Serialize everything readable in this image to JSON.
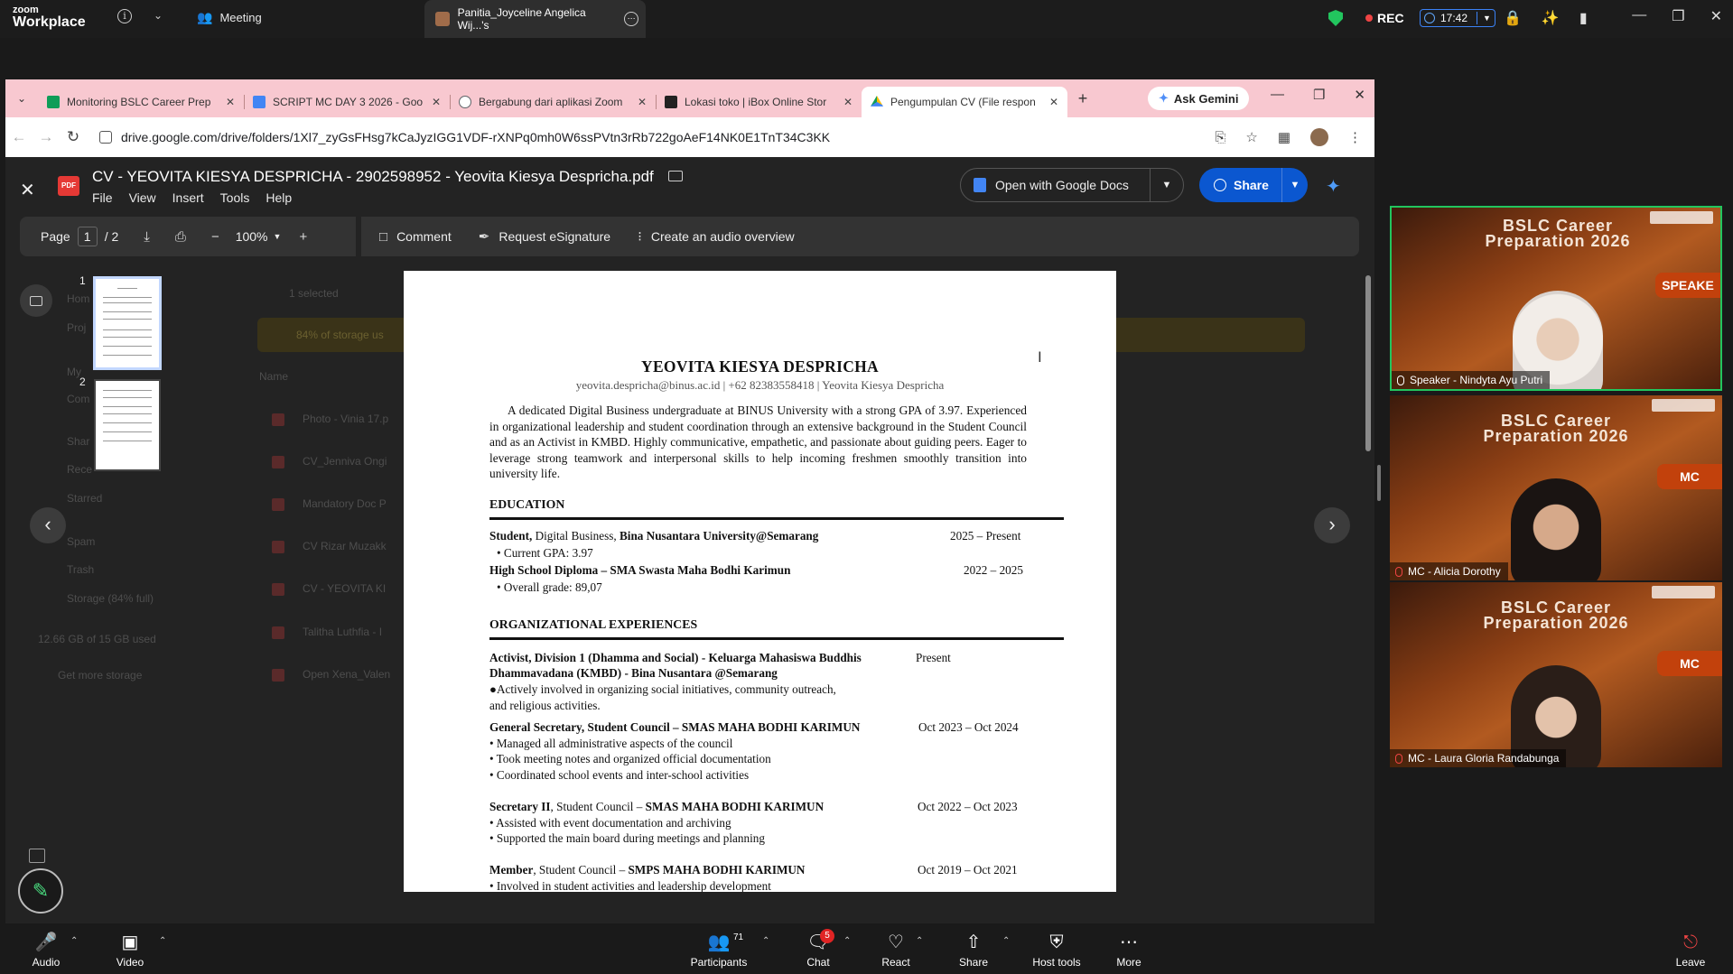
{
  "zoom": {
    "logo_line1": "zoom",
    "logo_line2": "Workplace",
    "meeting_label": "Meeting",
    "share_tab_title": "Panitia_Joyceline Angelica Wij...'s",
    "rec_label": "REC",
    "timer": "17:42",
    "bottom": {
      "audio": "Audio",
      "video": "Video",
      "participants": "Participants",
      "participants_count": "71",
      "chat": "Chat",
      "chat_badge": "5",
      "react": "React",
      "share": "Share",
      "host_tools": "Host tools",
      "more": "More",
      "leave": "Leave"
    },
    "participants": [
      {
        "title_line1": "BSLC Career",
        "title_line2": "Preparation 2026",
        "badge": "SPEAKE",
        "name": "Speaker - Nindyta Ayu Putri",
        "active": true
      },
      {
        "title_line1": "BSLC Career",
        "title_line2": "Preparation 2026",
        "badge": "MC",
        "name": "MC - Alicia Dorothy",
        "active": false
      },
      {
        "title_line1": "BSLC Career",
        "title_line2": "Preparation 2026",
        "badge": "MC",
        "name": "MC - Laura Gloria Randabunga",
        "active": false
      }
    ]
  },
  "chrome": {
    "tabs": [
      {
        "title": "Monitoring BSLC Career Prep",
        "fav_color": "#0f9d58"
      },
      {
        "title": "SCRIPT MC DAY 3 2026 - Goo",
        "fav_color": "#4285f4"
      },
      {
        "title": "Bergabung dari aplikasi Zoom",
        "fav_color": "#5f6368"
      },
      {
        "title": "Lokasi toko | iBox Online Stor",
        "fav_color": "#222222"
      },
      {
        "title": "Pengumpulan CV (File respon",
        "fav_color": "#fbbc04"
      }
    ],
    "ask_gemini": "Ask Gemini",
    "url": "drive.google.com/drive/folders/1Xl7_zyGsFHsg7kCaJyzIGG1VDF-rXNPq0mh0W6ssPVtn3rRb722goAeF14NK0E1TnT34C3KK"
  },
  "drive_bg": {
    "selected": "1 selected",
    "storage_warning": "84% of storage us",
    "name_header": "Name",
    "sidebar": [
      "Hom",
      "Proj",
      "My",
      "Com",
      "Shar",
      "Rece",
      "Starred",
      "Spam",
      "Trash",
      "Storage (84% full)",
      "12.66 GB of 15 GB used",
      "Get more storage"
    ],
    "files": [
      "Photo - Vinia 17.p",
      "CV_Jenniva Ongi",
      "Mandatory Doc P",
      "CV Rizar Muzakk",
      "CV - YEOVITA KI",
      "Talitha Luthfia - I",
      "Open Xena_Valen"
    ]
  },
  "viewer": {
    "title": "CV - YEOVITA KIESYA DESPRICHA - 2902598952 - Yeovita Kiesya Despricha.pdf",
    "menu": [
      "File",
      "View",
      "Insert",
      "Tools",
      "Help"
    ],
    "open_with": "Open with Google Docs",
    "share": "Share",
    "page_label": "Page",
    "page_current": "1",
    "page_total": "/  2",
    "zoom": "100%",
    "comment": "Comment",
    "esign": "Request eSignature",
    "audio_overview": "Create an audio overview",
    "thumb_nums": [
      "1",
      "2"
    ]
  },
  "cv": {
    "name": "YEOVITA KIESYA DESPRICHA",
    "contact": "yeovita.despricha@binus.ac.id | +62 82383558418 | Yeovita Kiesya Despricha",
    "summary": "A dedicated Digital Business undergraduate at BINUS University with a strong GPA of 3.97. Experienced in organizational leadership and student coordination through an extensive background in the Student Council and as an Activist in KMBD. Highly communicative, empathetic, and passionate about guiding peers. Eager to leverage strong teamwork and interpersonal skills to help incoming freshmen smoothly transition into university life.",
    "education_heading": "EDUCATION",
    "edu1_bold1": "Student,",
    "edu1_mid": " Digital Business, ",
    "edu1_bold2": "Bina Nusantara University@Semarang",
    "edu1_date": "2025 – Present",
    "edu1_bullet": "•   Current GPA: 3.97",
    "edu2_title": "High School Diploma – SMA Swasta Maha Bodhi Karimun",
    "edu2_date": "2022 – 2025",
    "edu2_bullet": "•   Overall grade: 89,07",
    "org_heading": "ORGANIZATIONAL EXPERIENCES",
    "org1_title1": "Activist, Division 1 (Dhamma and Social) - Keluarga Mahasiswa Buddhis",
    "org1_title2": "Dhammavadana (KMBD) - Bina Nusantara @Semarang",
    "org1_date": "Present",
    "org1_b1": "●Actively involved in organizing social initiatives, community outreach,",
    "org1_b2": "and religious activities.",
    "org2_title": "General Secretary, Student Council – SMAS MAHA BODHI KARIMUN",
    "org2_date": "Oct 2023 – Oct 2024",
    "org2_b1": "• Managed all administrative aspects of the council",
    "org2_b2": "• Took meeting notes and organized official documentation",
    "org2_b3": "• Coordinated school events and inter-school activities",
    "org3_bold1": "Secretary II",
    "org3_mid": ", Student Council – ",
    "org3_bold2": "SMAS MAHA BODHI KARIMUN",
    "org3_date": "Oct 2022 – Oct 2023",
    "org3_b1": "• Assisted with event documentation and archiving",
    "org3_b2": "• Supported the main board during meetings and planning",
    "org4_bold1": "Member",
    "org4_mid": ", Student Council – ",
    "org4_bold2": "SMPS MAHA BODHI KARIMUN",
    "org4_date": "Oct 2019 – Oct 2021",
    "org4_b1": "• Involved in student activities and leadership development"
  }
}
